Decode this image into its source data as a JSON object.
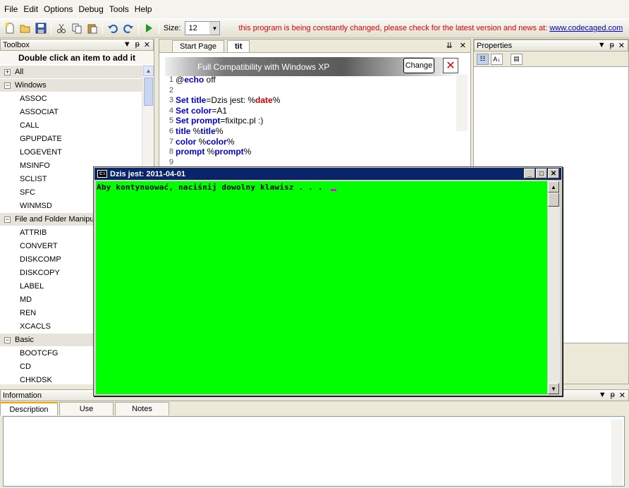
{
  "menu": [
    "File",
    "Edit",
    "Options",
    "Debug",
    "Tools",
    "Help"
  ],
  "toolbar": {
    "size_label": "Size:",
    "size_value": "12",
    "notice": "this program is being constantly changed, please check for the latest version and news at: ",
    "notice_link": "www.codecaged.com"
  },
  "toolbox": {
    "title": "Toolbox",
    "header": "Double click an item to add it",
    "rows": [
      {
        "type": "cat",
        "label": "All",
        "sign": "+"
      },
      {
        "type": "cat",
        "label": "Windows",
        "sign": "−"
      },
      {
        "type": "item",
        "label": "ASSOC"
      },
      {
        "type": "item",
        "label": "ASSOCIAT"
      },
      {
        "type": "item",
        "label": "CALL"
      },
      {
        "type": "item",
        "label": "GPUPDATE"
      },
      {
        "type": "item",
        "label": "LOGEVENT"
      },
      {
        "type": "item",
        "label": "MSINFO"
      },
      {
        "type": "item",
        "label": "SCLIST"
      },
      {
        "type": "item",
        "label": "SFC"
      },
      {
        "type": "item",
        "label": "WINMSD"
      },
      {
        "type": "cat",
        "label": "File and Folder Manipul",
        "sign": "−"
      },
      {
        "type": "item",
        "label": "ATTRIB"
      },
      {
        "type": "item",
        "label": "CONVERT"
      },
      {
        "type": "item",
        "label": "DISKCOMP"
      },
      {
        "type": "item",
        "label": "DISKCOPY"
      },
      {
        "type": "item",
        "label": "LABEL"
      },
      {
        "type": "item",
        "label": "MD"
      },
      {
        "type": "item",
        "label": "REN"
      },
      {
        "type": "item",
        "label": "XCACLS"
      },
      {
        "type": "cat",
        "label": "Basic",
        "sign": "−"
      },
      {
        "type": "item",
        "label": "BOOTCFG"
      },
      {
        "type": "item",
        "label": "CD"
      },
      {
        "type": "item",
        "label": "CHKDSK"
      }
    ]
  },
  "editor": {
    "tabs": [
      "Start Page",
      "tit"
    ],
    "compat_title": "Full Compatibility with Windows XP",
    "change_label": "Change",
    "lines": [
      {
        "n": "1",
        "parts": [
          [
            "p",
            "@"
          ],
          [
            "k",
            "echo"
          ],
          [
            "p",
            " off"
          ]
        ]
      },
      {
        "n": "2",
        "parts": []
      },
      {
        "n": "3",
        "parts": [
          [
            "k",
            "Set title"
          ],
          [
            "p",
            "=Dzis jest: %"
          ],
          [
            "v",
            "date"
          ],
          [
            "p",
            "%"
          ]
        ]
      },
      {
        "n": "4",
        "parts": [
          [
            "k",
            "Set color"
          ],
          [
            "p",
            "=A1"
          ]
        ]
      },
      {
        "n": "5",
        "parts": [
          [
            "k",
            "Set prompt"
          ],
          [
            "p",
            "=fixitpc.pl :)"
          ]
        ]
      },
      {
        "n": "6",
        "parts": [
          [
            "k",
            "title"
          ],
          [
            "p",
            " %"
          ],
          [
            "k",
            "title"
          ],
          [
            "p",
            "%"
          ]
        ]
      },
      {
        "n": "7",
        "parts": [
          [
            "k",
            "color"
          ],
          [
            "p",
            " %"
          ],
          [
            "k",
            "color"
          ],
          [
            "p",
            "%"
          ]
        ]
      },
      {
        "n": "8",
        "parts": [
          [
            "k",
            "prompt"
          ],
          [
            "p",
            " %"
          ],
          [
            "k",
            "prompt"
          ],
          [
            "p",
            "%"
          ]
        ]
      },
      {
        "n": "9",
        "parts": []
      }
    ]
  },
  "properties": {
    "title": "Properties"
  },
  "information": {
    "title": "Information",
    "tabs": [
      "Description",
      "Use",
      "Notes"
    ]
  },
  "console": {
    "title": "Dzis jest: 2011-04-01",
    "text": "Aby kontynuować, naciśnij dowolny klawisz . . . ",
    "bg_color": "#00ff00"
  }
}
